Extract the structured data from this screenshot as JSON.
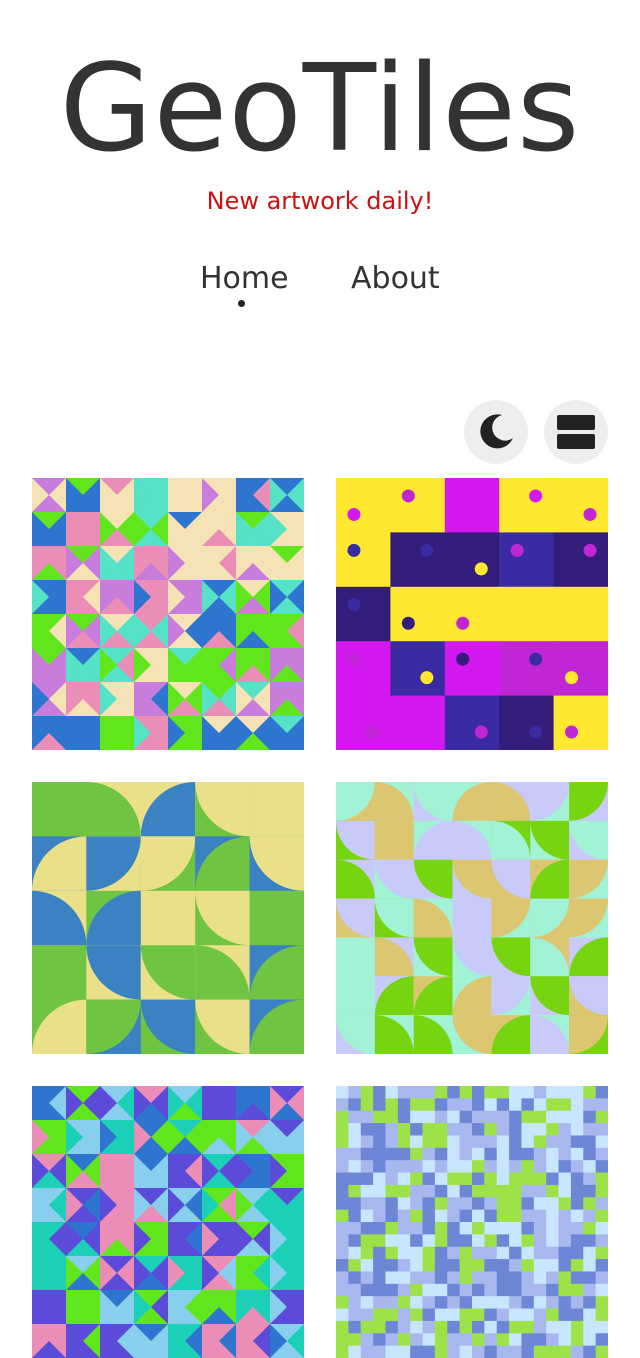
{
  "header": {
    "title": "GeoTiles",
    "tagline": "New artwork daily!"
  },
  "nav": {
    "items": [
      {
        "label": "Home",
        "active": true
      },
      {
        "label": "About",
        "active": false
      }
    ]
  },
  "controls": {
    "theme_icon": "moon-icon",
    "layout_icon": "list-layout-icon"
  },
  "colors": {
    "title": "#333333",
    "tagline": "#cc1111",
    "button_bg": "#eeeeee"
  },
  "gallery": {
    "tiles": [
      {
        "style": "triangles",
        "palette": [
          "#c87ddc",
          "#2e75cf",
          "#f6e3b5",
          "#55e2c6",
          "#61e61d",
          "#ea8eb7"
        ]
      },
      {
        "style": "dots",
        "palette": [
          "#ffe82f",
          "#3a2ba3",
          "#c025d6",
          "#341c7a",
          "#d419f0"
        ]
      },
      {
        "style": "quarter-circles",
        "palette": [
          "#6fc442",
          "#ebe08a",
          "#3b82c2"
        ]
      },
      {
        "style": "quarter-circles",
        "palette": [
          "#dcc671",
          "#c8cbfa",
          "#77d410",
          "#a2f2d6"
        ]
      },
      {
        "style": "triangles",
        "palette": [
          "#2e75cf",
          "#88cfee",
          "#61e61d",
          "#ea8eb7",
          "#1bd0b7",
          "#5b4bd8"
        ]
      },
      {
        "style": "pixels",
        "palette": [
          "#c8e6ff",
          "#6e86d6",
          "#9ee24a",
          "#a8b8ee"
        ]
      }
    ]
  }
}
